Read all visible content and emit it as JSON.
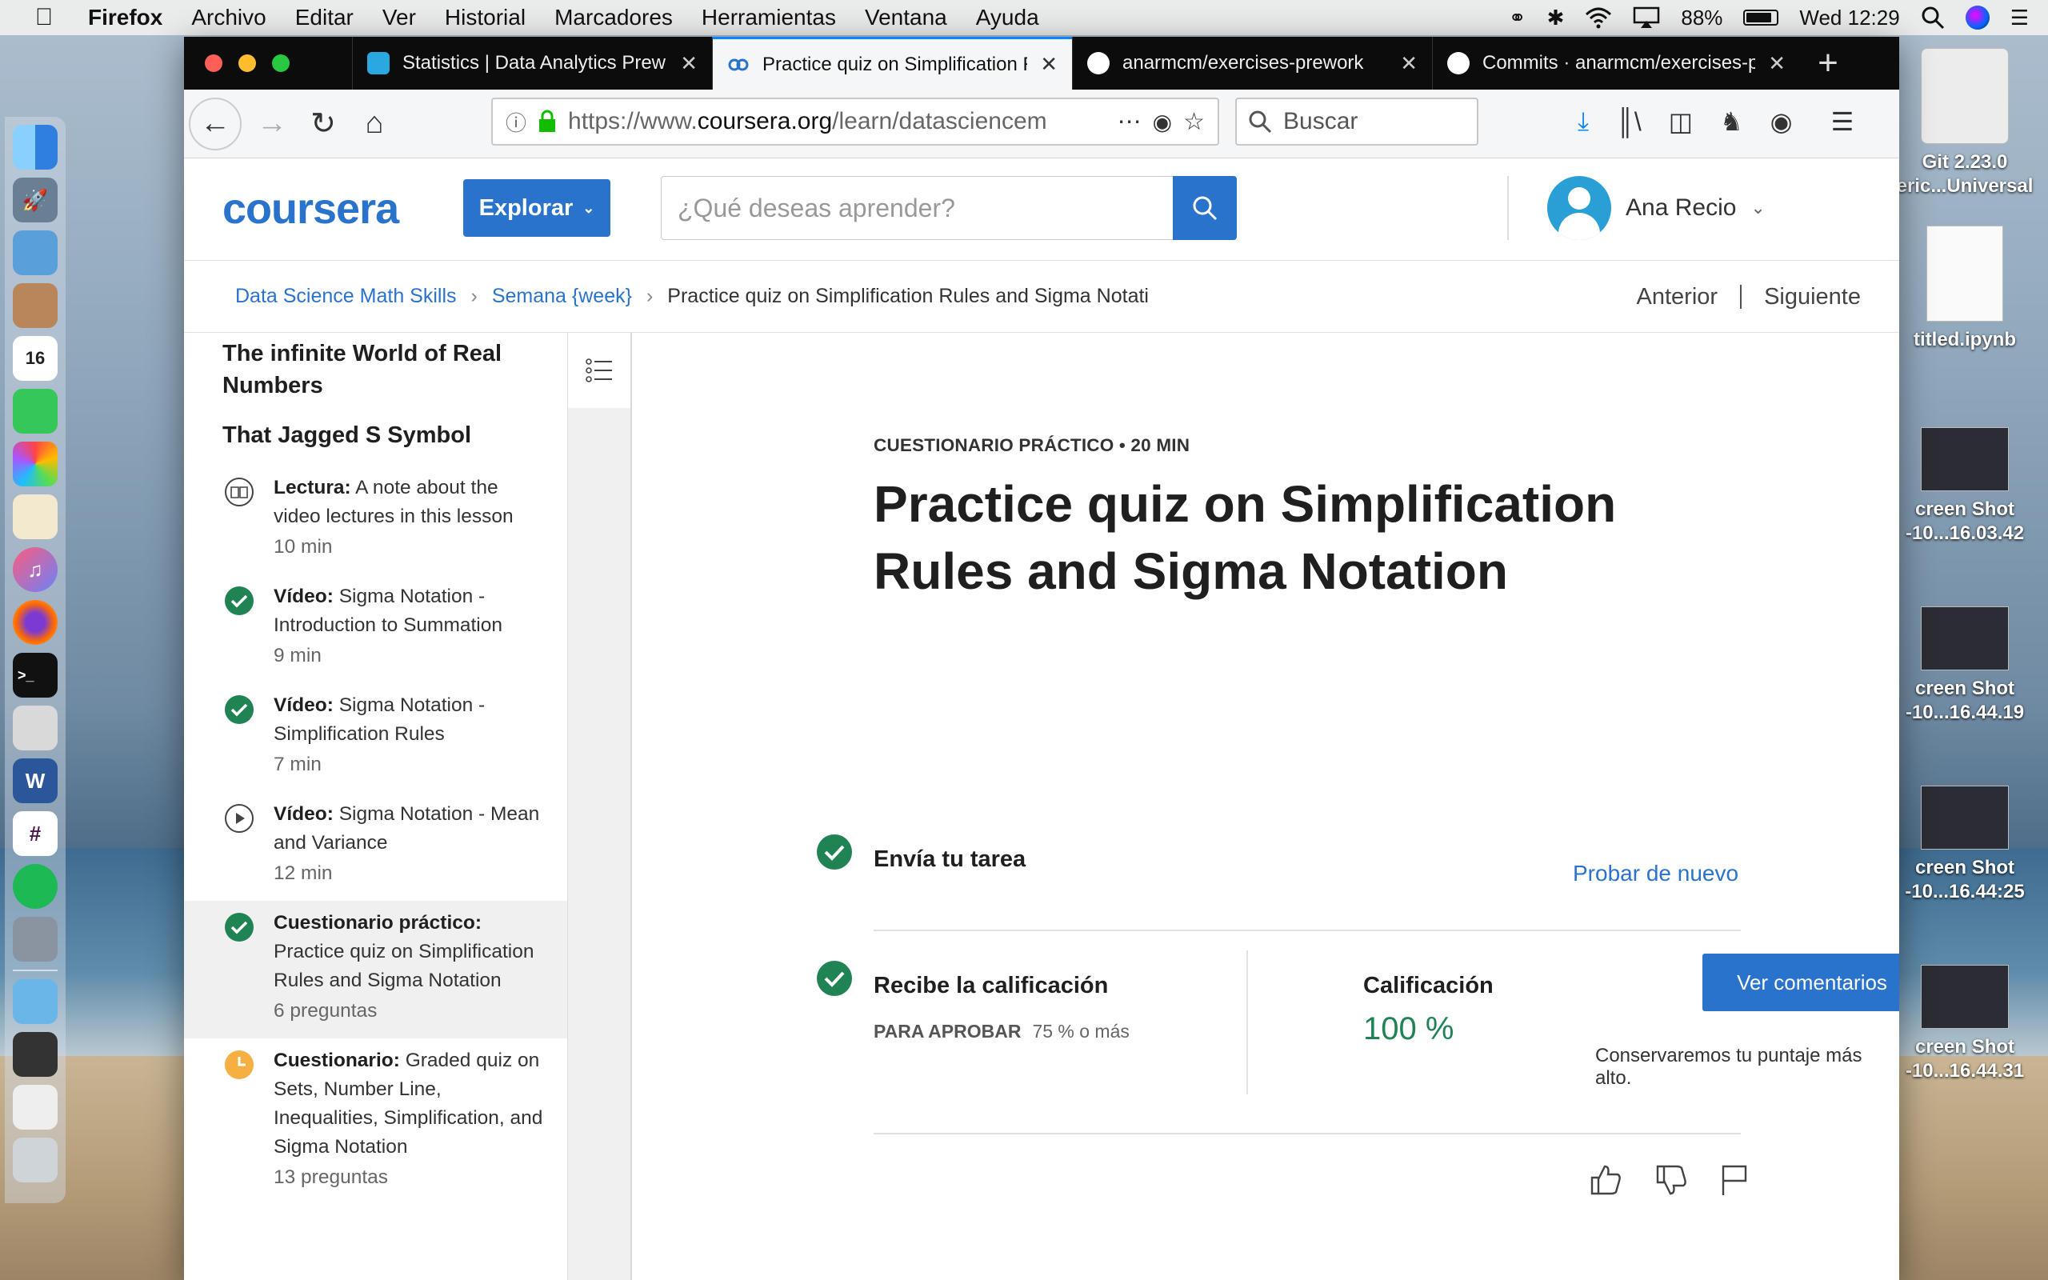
{
  "menubar": {
    "app": "Firefox",
    "items": [
      "Archivo",
      "Editar",
      "Ver",
      "Historial",
      "Marcadores",
      "Herramientas",
      "Ventana",
      "Ayuda"
    ],
    "battery": "88%",
    "clock": "Wed 12:29"
  },
  "desktop_icons": [
    {
      "label_1": "Git 2.23.0",
      "label_2": "eric...Universal"
    },
    {
      "label_1": "titled.ipynb",
      "label_2": ""
    },
    {
      "label_1": "creen Shot",
      "label_2": "-10...16.03.42"
    },
    {
      "label_1": "creen Shot",
      "label_2": "-10...16.44.19"
    },
    {
      "label_1": "creen Shot",
      "label_2": "-10...16.44:25"
    },
    {
      "label_1": "creen Shot",
      "label_2": "-10...16.44.31"
    }
  ],
  "browser": {
    "tabs": [
      {
        "title": "Statistics | Data Analytics Prew"
      },
      {
        "title": "Practice quiz on Simplification R"
      },
      {
        "title": "anarmcm/exercises-prework"
      },
      {
        "title": "Commits · anarmcm/exercises-p"
      }
    ],
    "url_prefix": "https://www.",
    "url_domain": "coursera.org",
    "url_suffix": "/learn/datasciencem",
    "search_placeholder": "Buscar"
  },
  "coursera": {
    "logo": "coursera",
    "explore_label": "Explorar",
    "search_placeholder": "¿Qué deseas aprender?",
    "user_name": "Ana Recio",
    "breadcrumb": [
      "Data Science Math Skills",
      "Semana {week}",
      "Practice quiz on Simplification Rules and Sigma Notati"
    ],
    "prev_label": "Anterior",
    "next_label": "Siguiente"
  },
  "sidebar": {
    "section_1": "The infinite World of Real Numbers",
    "section_2": "That Jagged S Symbol",
    "items": [
      {
        "type": "Lectura:",
        "title": "A note about the video lectures in this lesson",
        "duration": "10 min",
        "status": "reading"
      },
      {
        "type": "Vídeo:",
        "title": "Sigma Notation - Introduction to Summation",
        "duration": "9 min",
        "status": "done"
      },
      {
        "type": "Vídeo:",
        "title": "Sigma Notation - Simplification Rules",
        "duration": "7 min",
        "status": "done"
      },
      {
        "type": "Vídeo:",
        "title": "Sigma Notation - Mean and Variance",
        "duration": "12 min",
        "status": "play"
      },
      {
        "type": "Cuestionario práctico:",
        "title": "Practice quiz on Simplification Rules and Sigma Notation",
        "duration": "6 preguntas",
        "status": "done"
      },
      {
        "type": "Cuestionario:",
        "title": "Graded quiz on Sets, Number Line, Inequalities, Simplification, and Sigma Notation",
        "duration": "13 preguntas",
        "status": "pending"
      }
    ]
  },
  "main": {
    "kicker": "CUESTIONARIO PRÁCTICO • 20 MIN",
    "title": "Practice quiz on Simplification Rules and Sigma Notation",
    "step1": "Envía tu tarea",
    "retry": "Probar de nuevo",
    "step2": "Recibe la calificación",
    "pass_label": "PARA APROBAR",
    "pass_value": "75 % o más",
    "grade_label": "Calificación",
    "grade_value": "100 %",
    "feedback_button": "Ver comentarios",
    "keep_note": "Conservaremos tu puntaje más alto."
  },
  "colors": {
    "accent": "#2a73cc",
    "success": "#1f8354",
    "pending": "#f5b041"
  }
}
